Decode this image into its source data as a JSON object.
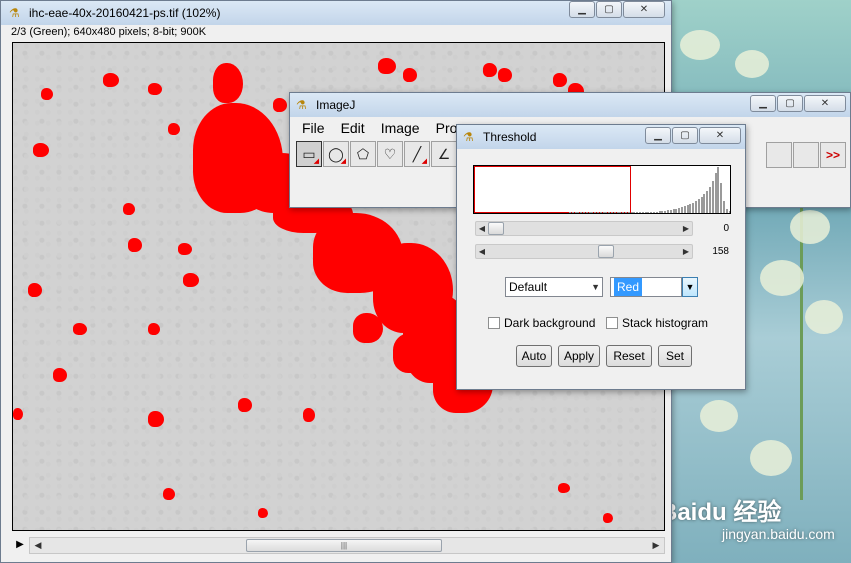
{
  "image_window": {
    "title": "ihc-eae-40x-20160421-ps.tif (102%)",
    "info": "2/3 (Green); 640x480 pixels; 8-bit; 900K",
    "threshold_color": "#ff0000"
  },
  "imagej_window": {
    "title": "ImageJ",
    "menus": [
      "File",
      "Edit",
      "Image",
      "Proc"
    ],
    "tools": [
      "rectangle-tool",
      "oval-tool",
      "polygon-tool",
      "freehand-tool",
      "line-tool",
      "angle-tool"
    ],
    "more_tools_label": ">>"
  },
  "threshold_dialog": {
    "title": "Threshold",
    "min_value": "0",
    "max_value": "158",
    "min_fraction": 0.0,
    "max_fraction": 0.62,
    "method": "Default",
    "display_mode": "Red",
    "dark_background_label": "Dark background",
    "stack_histogram_label": "Stack histogram",
    "buttons": {
      "auto": "Auto",
      "apply": "Apply",
      "reset": "Reset",
      "set": "Set"
    }
  },
  "watermark": {
    "logo": "Baidu 经验",
    "url": "jingyan.baidu.com"
  }
}
